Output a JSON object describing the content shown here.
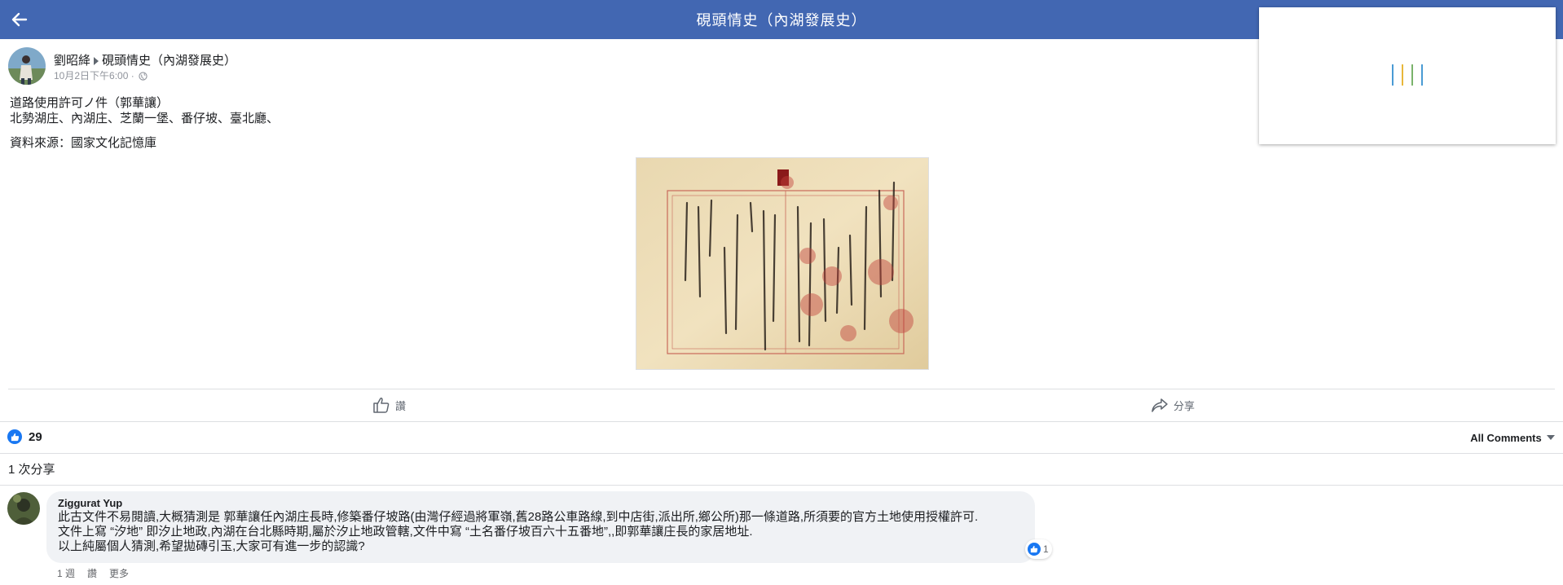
{
  "topbar": {
    "title": "硯頭情史（內湖發展史）",
    "bg_color": "#4267b2",
    "back_icon": "arrow-left-icon"
  },
  "post": {
    "author": "劉昭絳",
    "group": "硯頭情史（內湖發展史）",
    "timestamp": "10月2日下午6:00 ·",
    "privacy_icon": "globe-icon",
    "text_lines": [
      "道路使用許可ノ件（郭華讓）",
      "北勢湖庄、內湖庄、芝蘭一堡、番仔坡、臺北廳、"
    ],
    "source": "資料來源：國家文化記憶庫",
    "image_icon": "historical-document-image"
  },
  "actions": {
    "like_label": "讚",
    "share_label": "分享"
  },
  "stats": {
    "reaction_count": "29",
    "share_count": "1 次分享",
    "sort_label": "All Comments"
  },
  "comment": {
    "author": "Ziggurat Yup",
    "lines": [
      "此古文件不易閱讀,大概猜測是 郭華讓任內湖庄長時,修築番仔坡路(由灣仔經過將軍嶺,舊28路公車路線,到中店街,派出所,鄉公所)那一條道路,所須要的官方土地使用授權許可.",
      "文件上寫 “汐地” 即汐止地政,內湖在台北縣時期,屬於汐止地政管轄,文件中寫 “土名番仔坡百六十五番地”,,即郭華讓庄長的家居地址.",
      "以上純屬個人猜測,希望拋磚引玉,大家可有進一步的認識?"
    ],
    "reaction_count": "1",
    "age": "1 週",
    "like_label": "讚",
    "more_label": "更多"
  },
  "colors": {
    "accent": "#1877f2",
    "divider": "#dddfe2",
    "bubble": "#f0f2f5"
  }
}
